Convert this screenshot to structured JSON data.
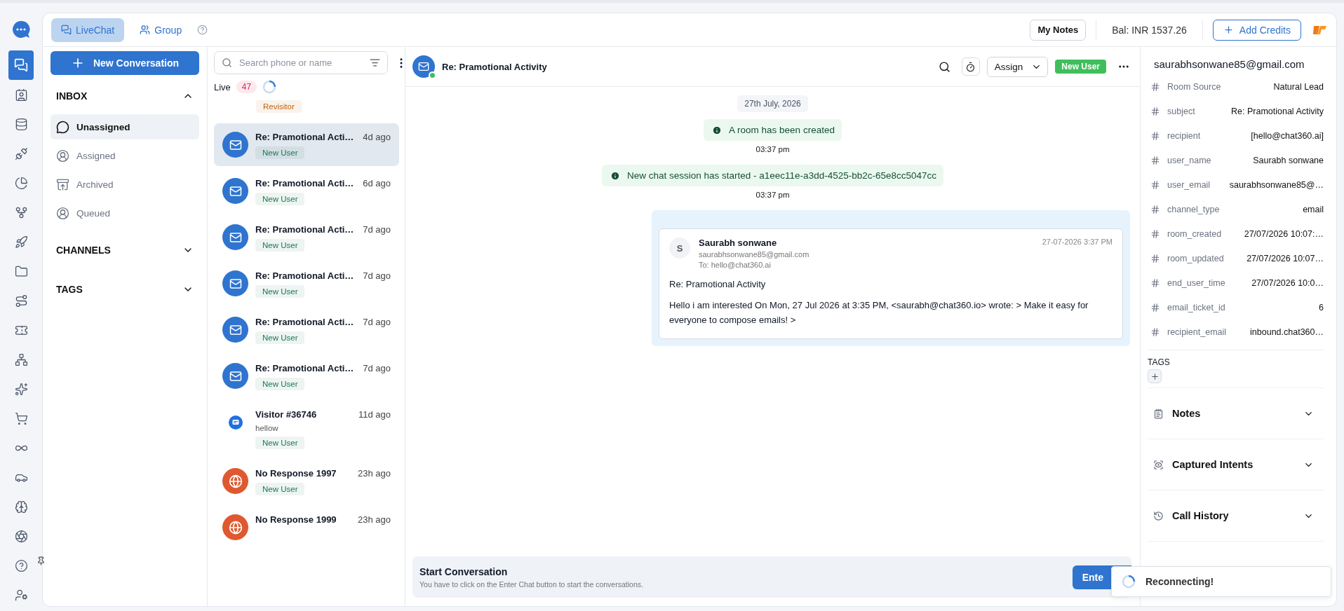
{
  "top_bar": {
    "tabs": [
      {
        "label": "LiveChat",
        "selected": true
      },
      {
        "label": "Group",
        "selected": false
      }
    ],
    "my_notes": "My Notes",
    "balance": "Bal: INR 1537.26",
    "add_credits": "Add Credits"
  },
  "inbox": {
    "new_conversation": "New Conversation",
    "sections": [
      {
        "title": "INBOX",
        "expanded": true,
        "items": [
          {
            "label": "Unassigned",
            "selected": true
          },
          {
            "label": "Assigned",
            "selected": false
          },
          {
            "label": "Archived",
            "selected": false
          },
          {
            "label": "Queued",
            "selected": false
          }
        ]
      },
      {
        "title": "CHANNELS",
        "expanded": false
      },
      {
        "title": "TAGS",
        "expanded": false
      }
    ]
  },
  "conversations": {
    "search": {
      "placeholder": "Search phone or name"
    },
    "live_label": "Live",
    "live_count": "47",
    "items": [
      {
        "kind": "partial",
        "badge": "Revisitor",
        "color": "#c2620c",
        "selected": false
      },
      {
        "kind": "email",
        "title": "Re: Pramotional Acti…",
        "time": "4d ago",
        "badge": "New User",
        "color": "#19794f",
        "selected": true
      },
      {
        "kind": "email",
        "title": "Re: Pramotional Acti…",
        "time": "6d ago",
        "badge": "New User",
        "color": "#19794f",
        "selected": false
      },
      {
        "kind": "email",
        "title": "Re: Pramotional Acti…",
        "time": "7d ago",
        "badge": "New User",
        "color": "#19794f",
        "selected": false
      },
      {
        "kind": "email",
        "title": "Re: Pramotional Acti…",
        "time": "7d ago",
        "badge": "New User",
        "color": "#19794f",
        "selected": false
      },
      {
        "kind": "email",
        "title": "Re: Pramotional Acti…",
        "time": "7d ago",
        "badge": "New User",
        "color": "#19794f",
        "selected": false
      },
      {
        "kind": "email",
        "title": "Re: Pramotional Acti…",
        "time": "7d ago",
        "badge": "New User",
        "color": "#19794f",
        "selected": false
      },
      {
        "kind": "chat",
        "title": "Visitor #36746",
        "time": "11d ago",
        "preview": "hellow",
        "badge": "New User",
        "color": "#19794f",
        "selected": false
      },
      {
        "kind": "web",
        "title": "No Response 1997",
        "time": "23h ago",
        "badge": "New User",
        "color": "#19794f",
        "selected": false
      },
      {
        "kind": "web",
        "title": "No Response 1999",
        "time": "23h ago",
        "selected": false
      }
    ]
  },
  "chat": {
    "title": "Re: Pramotional Activity",
    "online": true,
    "assign": "Assign",
    "user_badge": "New User",
    "date": "27th July, 2026",
    "events": [
      {
        "text": "A room has been created",
        "time": "03:37 pm"
      },
      {
        "text": "New chat session has started - a1eec11e-a3dd-4525-bb2c-65e8cc5047cc",
        "time": "03:37 pm"
      }
    ],
    "email": {
      "initial": "S",
      "sender": "Saurabh sonwane",
      "address": "saurabhsonwane85@gmail.com",
      "to": "To: hello@chat360.ai",
      "timestamp": "27-07-2026 3:37 PM",
      "subject": "Re: Pramotional Activity",
      "body": "Hello i am interested On Mon, 27 Jul 2026 at 3:35 PM, <saurabh@chat360.io> wrote: > Make it easy for everyone to compose emails! >"
    },
    "footer": {
      "title": "Start Conversation",
      "hint": "You have to click on the Enter Chat button to start the conversations.",
      "button": "Ente"
    }
  },
  "details": {
    "email": "saurabhsonwane85@gmail.com",
    "fields": [
      {
        "key": "Room Source",
        "value": "Natural Lead"
      },
      {
        "key": "subject",
        "value": "Re: Pramotional Activity"
      },
      {
        "key": "recipient",
        "value": "[hello@chat360.ai]"
      },
      {
        "key": "user_name",
        "value": "Saurabh sonwane"
      },
      {
        "key": "user_email",
        "value": "saurabhsonwane85@…"
      },
      {
        "key": "channel_type",
        "value": "email"
      },
      {
        "key": "room_created",
        "value": "27/07/2026 10:07:…"
      },
      {
        "key": "room_updated",
        "value": "27/07/2026 10:07…"
      },
      {
        "key": "end_user_time",
        "value": "27/07/2026 10:0…"
      },
      {
        "key": "email_ticket_id",
        "value": "6"
      },
      {
        "key": "recipient_email",
        "value": "inbound.chat360…"
      }
    ],
    "tags_label": "TAGS",
    "sections": [
      {
        "title": "Notes",
        "expanded": false
      },
      {
        "title": "Captured Intents",
        "expanded": false
      },
      {
        "title": "Call History",
        "expanded": false
      }
    ]
  },
  "toast": {
    "text": "Reconnecting!"
  }
}
